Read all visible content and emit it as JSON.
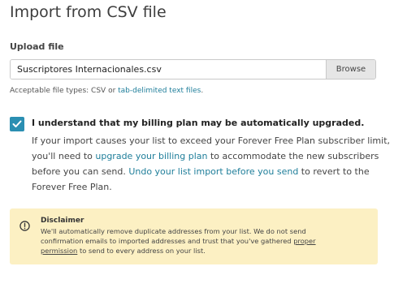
{
  "page": {
    "title": "Import from CSV file"
  },
  "upload": {
    "label": "Upload file",
    "file_value": "Suscriptores Internacionales.csv",
    "browse_label": "Browse",
    "help_prefix": "Acceptable file types: CSV or ",
    "help_link": "tab-delimited text files",
    "help_suffix": "."
  },
  "consent": {
    "checked": true,
    "heading": "I understand that my billing plan may be automatically upgraded.",
    "line1": "If your import causes your list to exceed your Forever Free Plan subscriber limit,",
    "line2_prefix": "you'll need to ",
    "line2_link": "upgrade your billing plan",
    "line2_suffix": " to accommodate the new subscribers",
    "line3_prefix": "before you can send. ",
    "line3_link": "Undo your list import before you send",
    "line3_suffix": " to revert to the",
    "line4": "Forever Free Plan."
  },
  "disclaimer": {
    "icon": "info-circle-icon",
    "title": "Disclaimer",
    "line1": "We'll automatically remove duplicate addresses from your list. We do not send",
    "line2_prefix": "confirmation emails to imported addresses and trust that you've gathered ",
    "line2_link": "proper",
    "line3_link": "permission",
    "line3_suffix": " to send to every address on your list."
  },
  "colors": {
    "accent": "#2b8fb2",
    "link": "#1f7e9a",
    "disclaimer_bg": "#fcf0c3",
    "button_bg": "#e6e6e6"
  }
}
